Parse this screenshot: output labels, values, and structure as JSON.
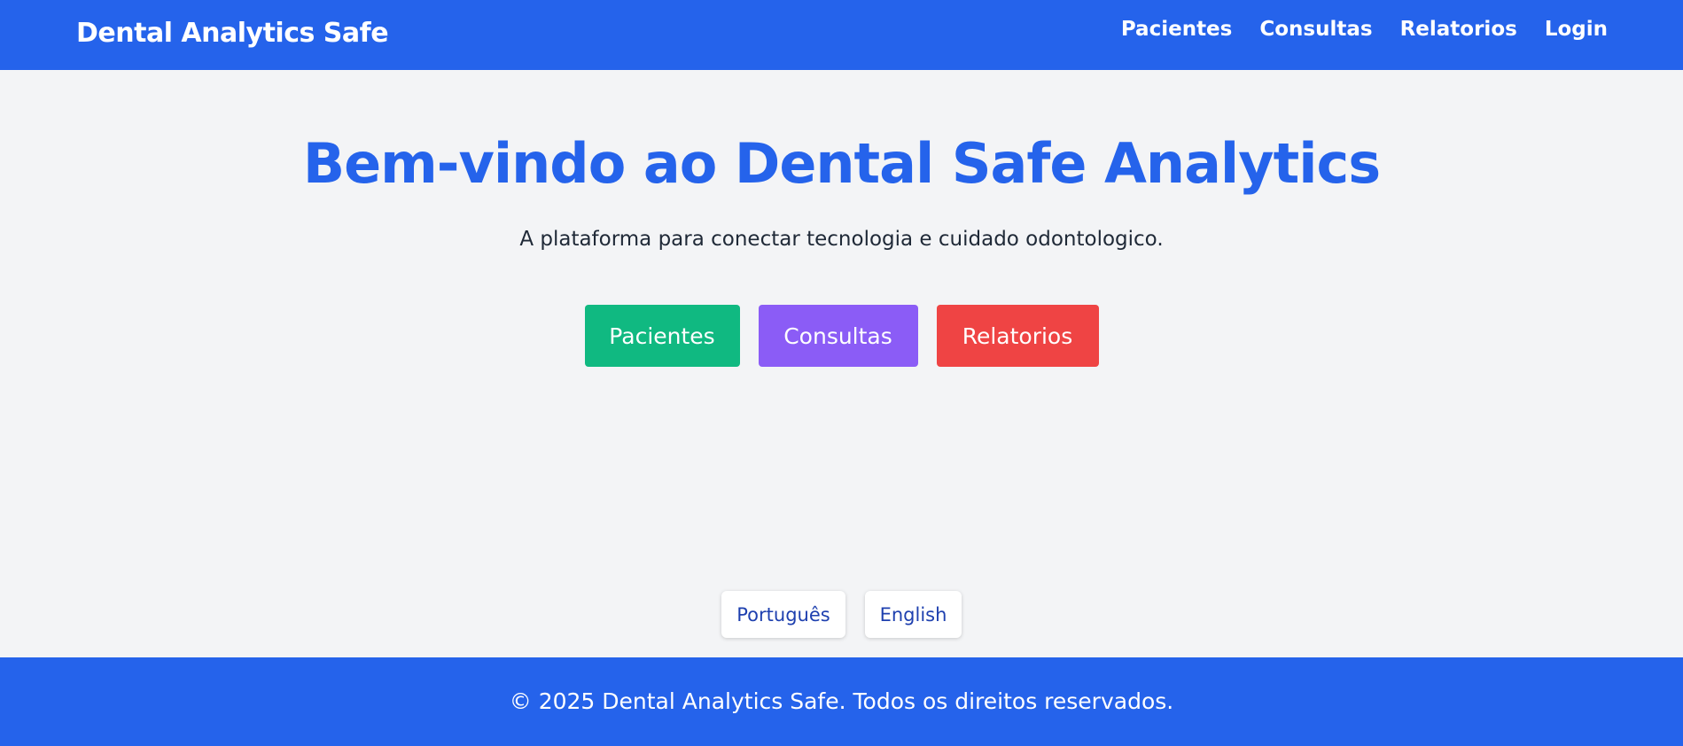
{
  "header": {
    "brand": "Dental Analytics Safe",
    "nav": [
      "Pacientes",
      "Consultas",
      "Relatorios",
      "Login"
    ]
  },
  "hero": {
    "title": "Bem-vindo ao Dental Safe Analytics",
    "subtitle": "A plataforma para conectar tecnologia e cuidado odontologico.",
    "buttons": [
      {
        "label": "Pacientes",
        "color": "#10b981"
      },
      {
        "label": "Consultas",
        "color": "#8b5cf6"
      },
      {
        "label": "Relatorios",
        "color": "#ef4444"
      }
    ]
  },
  "language": {
    "options": [
      "Português",
      "English"
    ]
  },
  "footer": {
    "text": "© 2025 Dental Analytics Safe. Todos os direitos reservados."
  },
  "colors": {
    "primary": "#2563eb",
    "background": "#f3f4f6"
  }
}
